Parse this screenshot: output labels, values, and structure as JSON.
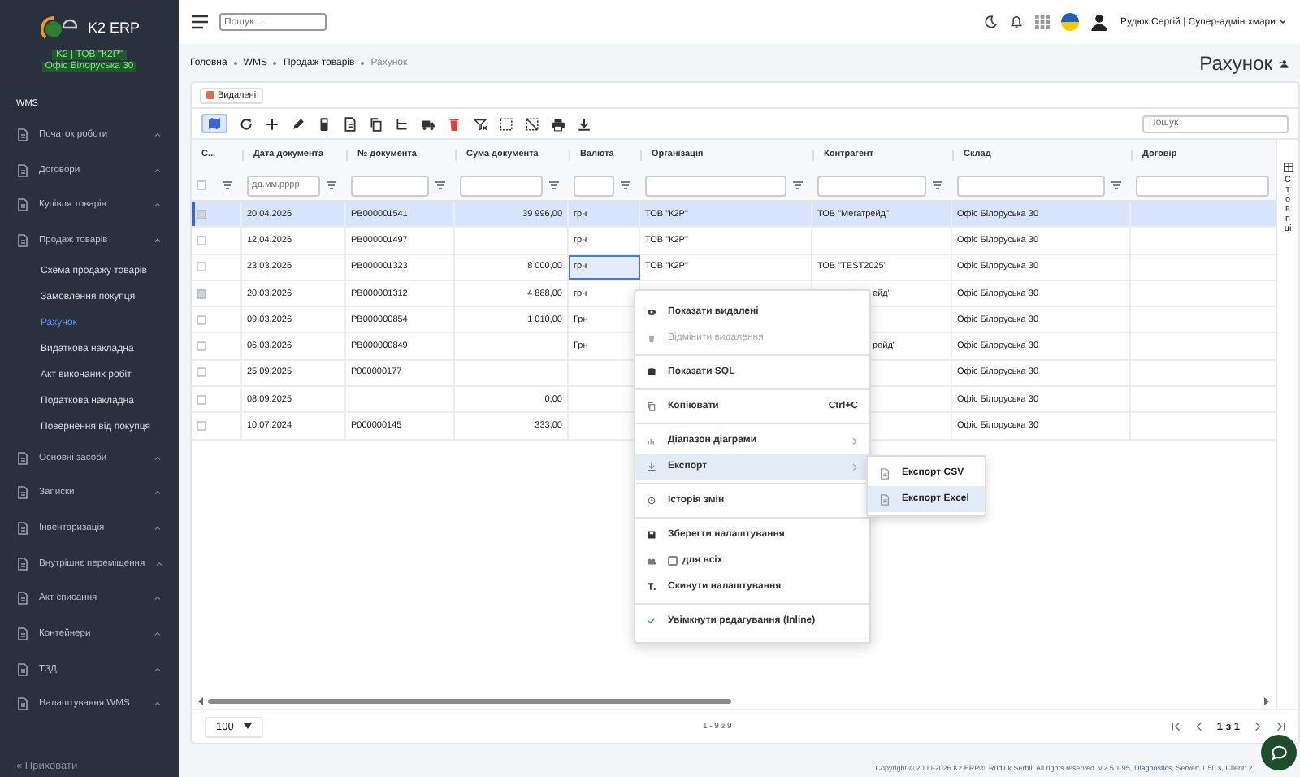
{
  "sidebar": {
    "brand": "K2 ERP",
    "company": "K2 | ТОВ \"К2Р\"",
    "office": "Офіс Білоруська 30",
    "section": "WMS",
    "items": [
      {
        "label": "Початок роботи",
        "expanded": false
      },
      {
        "label": "Договори",
        "expanded": false
      },
      {
        "label": "Купівля товарів",
        "expanded": false
      },
      {
        "label": "Продаж товарів",
        "expanded": true,
        "children": [
          {
            "label": "Схема продажу товарів",
            "selected": false
          },
          {
            "label": "Замовлення покупця",
            "selected": false
          },
          {
            "label": "Рахунок",
            "selected": true
          },
          {
            "label": "Видаткова накладна",
            "selected": false
          },
          {
            "label": "Акт виконаних робіт",
            "selected": false
          },
          {
            "label": "Податкова накладна",
            "selected": false
          },
          {
            "label": "Повернення від покупця",
            "selected": false
          }
        ]
      },
      {
        "label": "Основні засоби",
        "expanded": false
      },
      {
        "label": "Записки",
        "expanded": false
      },
      {
        "label": "Інвентаризація",
        "expanded": false
      },
      {
        "label": "Внутрішнє переміщення",
        "expanded": false
      },
      {
        "label": "Акт списання",
        "expanded": false
      },
      {
        "label": "Контейнери",
        "expanded": false
      },
      {
        "label": "ТЗД",
        "expanded": false
      },
      {
        "label": "Налаштування WMS",
        "expanded": false
      }
    ],
    "hide": "« Приховати"
  },
  "topbar": {
    "search_placeholder": "Пошук...",
    "user": "Рудюк Сергій | Супер-адмін хмари"
  },
  "breadcrumbs": [
    {
      "label": "Головна",
      "current": false
    },
    {
      "label": "WMS",
      "current": false
    },
    {
      "label": "Продаж товарів",
      "current": false
    },
    {
      "label": "Рахунок",
      "current": true
    }
  ],
  "page_title": "Рахунок",
  "deleted_chip": "Видалені",
  "toolbar_search_placeholder": "Пошук",
  "table": {
    "columns": [
      "С...",
      "Дата документа",
      "№ документа",
      "Сума документа",
      "Валюта",
      "Організація",
      "Контрагент",
      "Склад",
      "Договір"
    ],
    "date_filter_placeholder": "дд.мм.рррр",
    "select_all_checked": false,
    "rows": [
      {
        "selected": true,
        "checked": true,
        "date": "20.04.2026",
        "number": "РВ000001541",
        "sum": "39 996,00",
        "currency": "грн",
        "currency_focused": false,
        "organization": "ТОВ \"К2Р\"",
        "contragent": "ТОВ \"Мегатрейд\"",
        "contragent_clipped": false,
        "warehouse": "Офіс Білоруська 30"
      },
      {
        "selected": false,
        "checked": false,
        "date": "12.04.2026",
        "number": "РВ000001497",
        "currency": "грн",
        "currency_focused": false,
        "organization": "ТОВ \"К2Р\"",
        "warehouse": "Офіс Білоруська 30"
      },
      {
        "selected": false,
        "checked": false,
        "date": "23.03.2026",
        "number": "РВ000001323",
        "sum": "8 000,00",
        "currency": "грн",
        "currency_focused": true,
        "organization": "ТОВ \"К2Р\"",
        "contragent": "ТОВ \"TEST2025\"",
        "contragent_clipped": false,
        "warehouse": "Офіс Білоруська 30"
      },
      {
        "selected": false,
        "checked": true,
        "date": "20.03.2026",
        "number": "РВ000001312",
        "sum": "4 888,00",
        "currency": "грн",
        "currency_focused": false,
        "contragent": "ейд\"",
        "contragent_clipped": true,
        "warehouse": "Офіс Білоруська 30"
      },
      {
        "selected": false,
        "checked": false,
        "date": "09.03.2026",
        "number": "РВ000000854",
        "sum": "1 010,00",
        "currency": "Грн",
        "currency_focused": false,
        "warehouse": "Офіс Білоруська 30"
      },
      {
        "selected": false,
        "checked": false,
        "date": "06.03.2026",
        "number": "РВ000000849",
        "currency": "Грн",
        "currency_focused": false,
        "contragent": "рейд\"",
        "contragent_clipped": true,
        "warehouse": "Офіс Білоруська 30"
      },
      {
        "selected": false,
        "checked": false,
        "date": "25.09.2025",
        "number": "Р000000177",
        "currency_focused": false,
        "warehouse": "Офіс Білоруська 30"
      },
      {
        "selected": false,
        "checked": false,
        "date": "08.09.2025",
        "sum": "0,00",
        "currency_focused": false,
        "warehouse": "Офіс Білоруська 30"
      },
      {
        "selected": false,
        "checked": false,
        "date": "10.07.2024",
        "number": "Р000000145",
        "sum": "333,00",
        "currency_focused": false,
        "warehouse": "Офіс Білоруська 30"
      }
    ]
  },
  "columns_tab": "Стовпці",
  "pagination": {
    "page_size": "100",
    "range": "1 - 9 з 9",
    "page": "1 з 1"
  },
  "context_menu": {
    "groups": [
      [
        {
          "label": "Показати видалені",
          "disabled": false,
          "selected": false
        },
        {
          "label": "Відмінити видалення",
          "disabled": true,
          "selected": false
        }
      ],
      [
        {
          "label": "Показати SQL",
          "disabled": false,
          "selected": false
        }
      ],
      [
        {
          "label": "Копіювати",
          "shortcut": "Ctrl+C",
          "disabled": false,
          "selected": false
        }
      ],
      [
        {
          "label": "Діапазон діаграми",
          "submenu": true,
          "disabled": false,
          "selected": false
        },
        {
          "label": "Експорт",
          "submenu": true,
          "disabled": false,
          "selected": true
        }
      ],
      [
        {
          "label": "Історія змін",
          "disabled": false,
          "selected": false
        }
      ],
      [
        {
          "label": "Зберегти налаштування",
          "disabled": false,
          "selected": false
        },
        {
          "label": "для всіх",
          "kind": "checkbox",
          "checked": false,
          "disabled": false,
          "selected": false
        },
        {
          "label": "Скинути налаштування",
          "disabled": false,
          "selected": false
        }
      ],
      [
        {
          "label": "Увімкнути редагування (Inline)",
          "disabled": false,
          "selected": false
        }
      ]
    ],
    "submenu": [
      {
        "label": "Експорт CSV",
        "selected": false
      },
      {
        "label": "Експорт Excel",
        "selected": true
      }
    ]
  },
  "footer": {
    "copyright": "Copyright © 2000-2026 K2 ERP®. Rudiuk Serhii. All rights reserved. v.2.5.1.95,",
    "link": "Diagnostics",
    "tail": ", Server: 1.50 s, Client: 2."
  }
}
